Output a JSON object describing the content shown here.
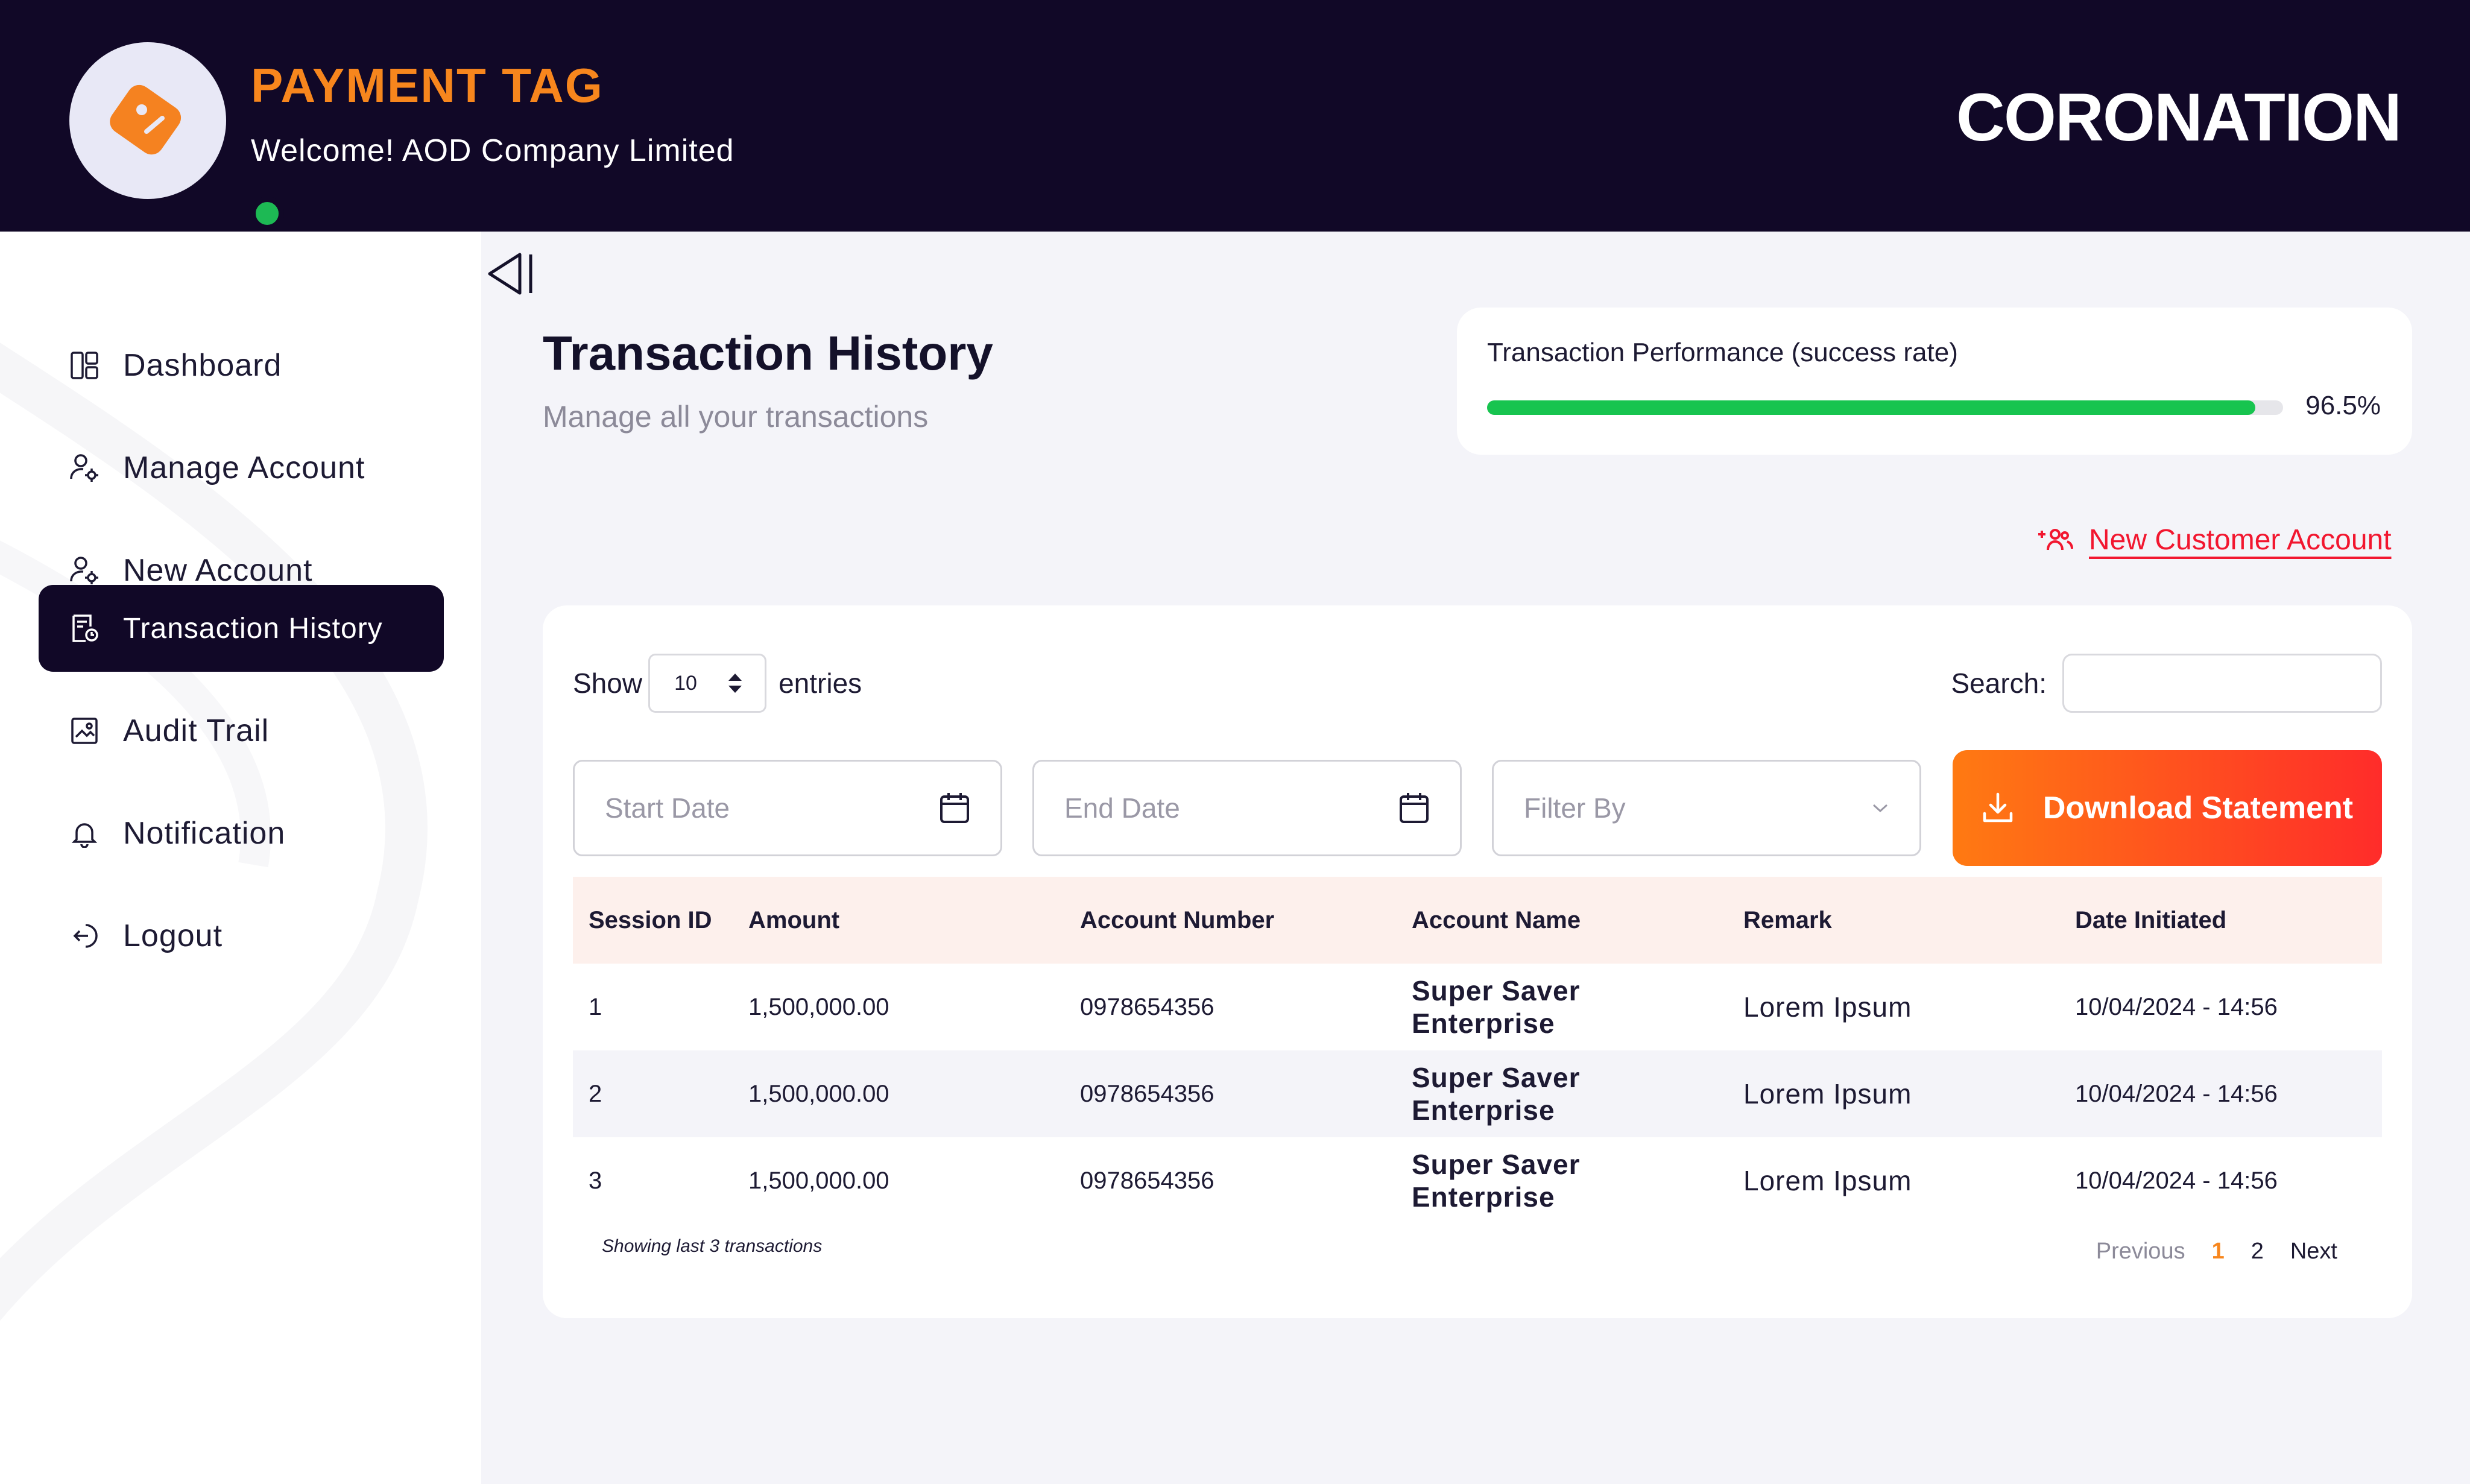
{
  "header": {
    "app_title": "PAYMENT TAG",
    "welcome": "Welcome! AOD Company Limited",
    "brand": "CORONATION",
    "logo_icon": "price-tag-icon",
    "status_color": "#1db954"
  },
  "sidebar": {
    "items": [
      {
        "label": "Dashboard",
        "icon": "dashboard-icon"
      },
      {
        "label": "Manage Account",
        "icon": "user-settings-icon"
      },
      {
        "label": "New Account",
        "icon": "user-settings-icon"
      },
      {
        "label": "Transaction History",
        "icon": "receipt-clock-icon",
        "active": true
      },
      {
        "label": "Audit Trail",
        "icon": "audit-image-icon"
      },
      {
        "label": "Notification",
        "icon": "bell-icon"
      },
      {
        "label": "Logout",
        "icon": "logout-icon"
      }
    ]
  },
  "page": {
    "title": "Transaction History",
    "subtitle": "Manage all your transactions"
  },
  "performance": {
    "label": "Transaction Performance (success rate)",
    "value_text": "96.5%",
    "value": 96.5,
    "color": "#17c44f"
  },
  "actions": {
    "new_customer": "New Customer Account",
    "download": "Download Statement"
  },
  "table_controls": {
    "show_label": "Show",
    "entries_value": "10",
    "entries_label": "entries",
    "search_label": "Search:",
    "search_value": "",
    "start_date_placeholder": "Start Date",
    "end_date_placeholder": "End Date",
    "filter_placeholder": "Filter By"
  },
  "table": {
    "columns": [
      "Session ID",
      "Amount",
      "Account Number",
      "Account Name",
      "Remark",
      "Date Initiated"
    ],
    "rows": [
      {
        "session_id": "1",
        "amount": "1,500,000.00",
        "account_number": "0978654356",
        "account_name": "Super Saver Enterprise",
        "remark": "Lorem Ipsum",
        "date": "10/04/2024 - 14:56"
      },
      {
        "session_id": "2",
        "amount": "1,500,000.00",
        "account_number": "0978654356",
        "account_name": "Super Saver Enterprise",
        "remark": "Lorem Ipsum",
        "date": "10/04/2024 - 14:56"
      },
      {
        "session_id": "3",
        "amount": "1,500,000.00",
        "account_number": "0978654356",
        "account_name": "Super Saver Enterprise",
        "remark": "Lorem Ipsum",
        "date": "10/04/2024 - 14:56"
      }
    ],
    "footer_note": "Showing last 3 transactions"
  },
  "pagination": {
    "previous": "Previous",
    "pages": [
      "1",
      "2"
    ],
    "current": "1",
    "next": "Next"
  },
  "colors": {
    "header_bg": "#110827",
    "accent_orange": "#f7861d",
    "accent_red": "#f2162f",
    "table_head_bg": "#fdf0ec"
  }
}
